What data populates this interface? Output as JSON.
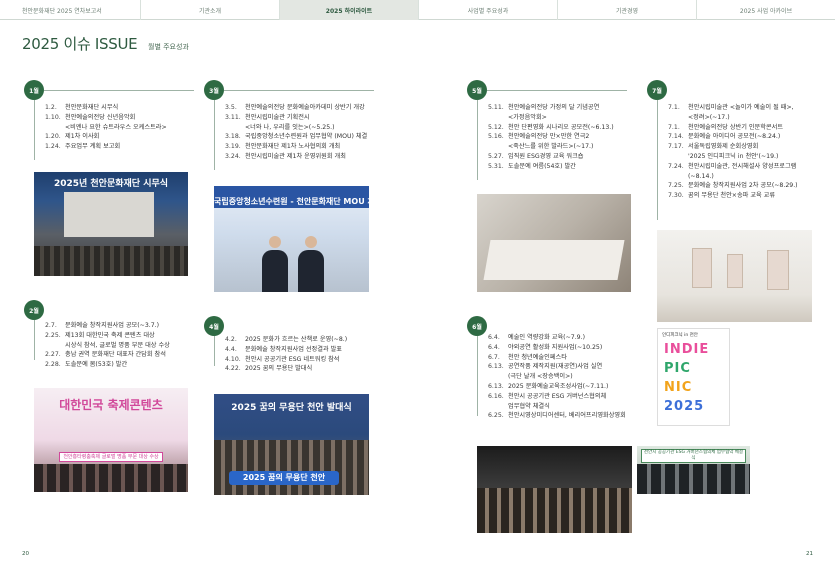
{
  "nav": {
    "items": [
      {
        "label": "천안문화재단 2025 연차보고서",
        "active": false
      },
      {
        "label": "기관소개",
        "active": false
      },
      {
        "label": "2025 하이라이트",
        "active": true
      },
      {
        "label": "사업별 주요성과",
        "active": false
      },
      {
        "label": "기관경영",
        "active": false
      },
      {
        "label": "2025 사업 아카이브",
        "active": false
      }
    ]
  },
  "heading": {
    "title": "2025 이슈 ISSUE",
    "subtitle": "월별 주요성과"
  },
  "months": {
    "m1": {
      "badge": "1월",
      "entries": [
        {
          "date": "1.2.",
          "text": "천안문화재단 시무식"
        },
        {
          "date": "1.10.",
          "text": "천안예술의전당 신년음악회"
        },
        {
          "date": "",
          "text": "<비엔나 요한 슈트라우스 오케스트라>"
        },
        {
          "date": "1.20.",
          "text": "제1차 이사회"
        },
        {
          "date": "1.24.",
          "text": "주요업무 계획 보고회"
        }
      ]
    },
    "m2": {
      "badge": "2월",
      "entries": [
        {
          "date": "2.7.",
          "text": "문화예술 창작지원사업 공모(~3.7.)"
        },
        {
          "date": "2.25.",
          "text": "제13회 대한민국 축제 콘텐츠 대상"
        },
        {
          "date": "",
          "text": "시상식 참석, 글로벌 명품 부문 대상 수상"
        },
        {
          "date": "2.27.",
          "text": "충남 권역 문화재단 대표자 간담회 참석"
        },
        {
          "date": "2.28.",
          "text": "도솔문예 봄(53호) 발간"
        }
      ]
    },
    "m3": {
      "badge": "3월",
      "entries": [
        {
          "date": "3.5.",
          "text": "천안예술의전당 문화예술아카데미 상반기 개강"
        },
        {
          "date": "3.11.",
          "text": "천안시립미술관 기획전시"
        },
        {
          "date": "",
          "text": "<너와 나, 우리를 잇는>(~5.25.)"
        },
        {
          "date": "3.18.",
          "text": "국립중앙청소년수련원과 업무협약 (MOU) 체결"
        },
        {
          "date": "3.19.",
          "text": "천안문화재단 제1차 노사협의회 개최"
        },
        {
          "date": "3.24.",
          "text": "천안시립미술관 제1차 운영위원회 개최"
        }
      ]
    },
    "m4": {
      "badge": "4월",
      "entries": [
        {
          "date": "4.2.",
          "text": "2025 문화가 흐르는 산책로 운영(~8.)"
        },
        {
          "date": "4.4.",
          "text": "문화예술 창작지원사업 선정결과 발표"
        },
        {
          "date": "4.10.",
          "text": "천안시 공공기관 ESG 네트워킹 참석"
        },
        {
          "date": "4.22.",
          "text": "2025 꿈의 무용단 발대식"
        }
      ]
    },
    "m5": {
      "badge": "5월",
      "entries": [
        {
          "date": "5.11.",
          "text": "천안예술의전당 가정의 달 기념공연"
        },
        {
          "date": "",
          "text": "<가정음악회>"
        },
        {
          "date": "5.12.",
          "text": "천안 단편영화 시나리오 공모전(~6.13.)"
        },
        {
          "date": "5.16.",
          "text": "천안예술의전당 만×만한 연극2"
        },
        {
          "date": "",
          "text": "<죽산느를 위한 발라드>(~17.)"
        },
        {
          "date": "5.27.",
          "text": "임직원 ESG경영 교육 워크숍"
        },
        {
          "date": "5.31.",
          "text": "도솔문예 여름(54호) 발간"
        }
      ]
    },
    "m6": {
      "badge": "6월",
      "entries": [
        {
          "date": "6.4.",
          "text": "예술인 역량강화 교육(~7.9.)"
        },
        {
          "date": "6.4.",
          "text": "야외공연 활성화 지원사업(~10.25)"
        },
        {
          "date": "6.7.",
          "text": "천안 청년예술인페스타"
        },
        {
          "date": "6.13.",
          "text": "공연작품 제작지원(재공연)사업 실연"
        },
        {
          "date": "",
          "text": "(극단 날개 <장승백이>)"
        },
        {
          "date": "6.13.",
          "text": "2025 문화예술교육조성사업(~7.11.)"
        },
        {
          "date": "6.16.",
          "text": "천안시 공공기관 ESG 거버넌스협의체"
        },
        {
          "date": "",
          "text": "업무협약 체결식"
        },
        {
          "date": "6.25.",
          "text": "천안시영상미디어센터, 베리어프리영화상영회"
        }
      ]
    },
    "m7": {
      "badge": "7월",
      "entries": [
        {
          "date": "7.1.",
          "text": "천안시립미술관 <놀이가 예술이 될 때>,"
        },
        {
          "date": "",
          "text": "<정려>(~17.)"
        },
        {
          "date": "7.1.",
          "text": "천안예술의전당 상반기 인문학콘서트"
        },
        {
          "date": "7.14.",
          "text": "문화예술 아이디어 공모전(~8.24.)"
        },
        {
          "date": "7.17.",
          "text": "서울독립영화제 순회상영회"
        },
        {
          "date": "",
          "text": "'2025 인디피크닉 in 천안'(~19.)"
        },
        {
          "date": "7.24.",
          "text": "천안시립미술관, 전시해설사 양성프로그램"
        },
        {
          "date": "",
          "text": "(~8.14.)"
        },
        {
          "date": "7.25.",
          "text": "문화예술 창작지원사업 2차 공모(~8.29.)"
        },
        {
          "date": "7.30.",
          "text": "꿈의 무용단 천안×송파 교육 교류"
        }
      ]
    }
  },
  "photos": {
    "sinyeon_banner": "2025년 천안문화재단 시무식",
    "mou_banner": "국립중앙청소년수련원 - 천안문화재단 MOU 체결",
    "festival_text": "대한민국 축제콘텐츠",
    "festival_strip": "천안흥타령춤축제 글로벌 명품 부문 대상 수상",
    "dream_banner": "2025 꿈의 무용단 천안 발대식",
    "dream_board": "2025 꿈의 무용단 천안",
    "poster_title": "인디피크닉 in 천안",
    "poster_lines": [
      "INDIE",
      "PIC",
      "NIC",
      "2025"
    ],
    "agree_banner": "천안시 공공기관 ESG 거버넌스협의체 업무협약 체결식"
  },
  "page_numbers": {
    "left": "20",
    "right": "21"
  },
  "colors": {
    "accent": "#2e6a43",
    "poster_1": "#e94e9b",
    "poster_2": "#2fa66b",
    "poster_3": "#f2a31b",
    "poster_4": "#3c6fd8"
  }
}
